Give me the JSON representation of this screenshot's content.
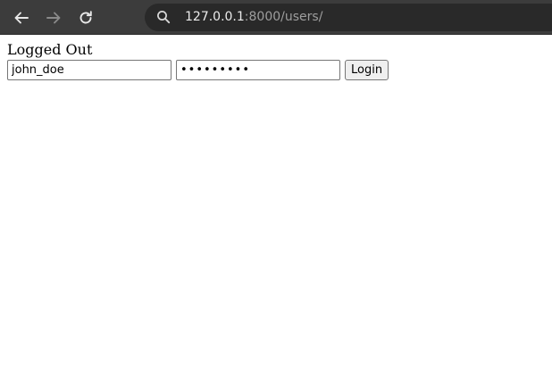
{
  "browser": {
    "url_host": "127.0.0.1",
    "url_rest": ":8000/users/",
    "icons": {
      "back": "arrow-left-icon",
      "forward": "arrow-right-icon",
      "reload": "reload-icon",
      "search": "search-icon"
    }
  },
  "page": {
    "status_heading": "Logged Out",
    "login_form": {
      "username_value": "john_doe",
      "password_value": "password1",
      "login_label": "Login"
    }
  }
}
